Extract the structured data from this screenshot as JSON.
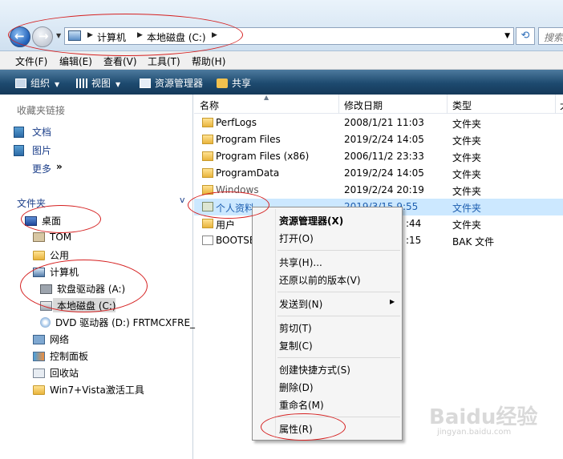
{
  "address_bar": {
    "crumbs": [
      "计算机",
      "本地磁盘 (C:)"
    ],
    "search_placeholder": "搜索"
  },
  "menubar": [
    "文件(F)",
    "编辑(E)",
    "查看(V)",
    "工具(T)",
    "帮助(H)"
  ],
  "toolbar": {
    "organize": "组织",
    "views": "视图",
    "explorer": "资源管理器",
    "share": "共享"
  },
  "favorites": {
    "heading": "收藏夹链接",
    "items": [
      "文档",
      "图片"
    ],
    "more": "更多",
    "more_chevron": "»"
  },
  "folders": {
    "heading": "文件夹",
    "chevron": "v",
    "tree": [
      {
        "label": "桌面",
        "icon": "desktop-icon"
      },
      {
        "label": "TOM",
        "icon": "user-icon"
      },
      {
        "label": "公用",
        "icon": "folder-icon"
      },
      {
        "label": "计算机",
        "icon": "computer-icon"
      },
      {
        "label": "软盘驱动器 (A:)",
        "icon": "floppy-icon"
      },
      {
        "label": "本地磁盘 (C:)",
        "icon": "drive-icon"
      },
      {
        "label": "DVD 驱动器 (D:) FRTMCXFRE_",
        "icon": "dvd-icon"
      },
      {
        "label": "网络",
        "icon": "network-icon"
      },
      {
        "label": "控制面板",
        "icon": "control-panel-icon"
      },
      {
        "label": "回收站",
        "icon": "recycle-bin-icon"
      },
      {
        "label": "Win7+Vista激活工具",
        "icon": "folder-icon"
      }
    ]
  },
  "columns": {
    "name": "名称",
    "date": "修改日期",
    "type": "类型",
    "more": "大"
  },
  "files": [
    {
      "name": "PerfLogs",
      "date": "2008/1/21 11:03",
      "type": "文件夹"
    },
    {
      "name": "Program Files",
      "date": "2019/2/24 14:05",
      "type": "文件夹"
    },
    {
      "name": "Program Files (x86)",
      "date": "2006/11/2 23:33",
      "type": "文件夹"
    },
    {
      "name": "ProgramData",
      "date": "2019/2/24 14:05",
      "type": "文件夹"
    },
    {
      "name": "Windows",
      "date": "2019/2/24 20:19",
      "type": "文件夹"
    },
    {
      "name": "个人资料",
      "date": "2019/3/15 9:55",
      "type": "文件夹"
    },
    {
      "name": "用户",
      "date": ":44",
      "type": "文件夹"
    },
    {
      "name": "BOOTSE",
      "date": ":15",
      "type": "BAK 文件"
    }
  ],
  "context_menu": {
    "explorer": "资源管理器(X)",
    "open": "打开(O)",
    "share": "共享(H)...",
    "restore": "还原以前的版本(V)",
    "send_to": "发送到(N)",
    "cut": "剪切(T)",
    "copy": "复制(C)",
    "shortcut": "创建快捷方式(S)",
    "delete": "删除(D)",
    "rename": "重命名(M)",
    "properties": "属性(R)"
  },
  "watermark": {
    "logo": "Baidu经验",
    "url": "jingyan.baidu.com"
  },
  "colors": {
    "toolbar": "#1d4a6f",
    "selection": "#cce8ff",
    "annotation": "#d52020"
  }
}
